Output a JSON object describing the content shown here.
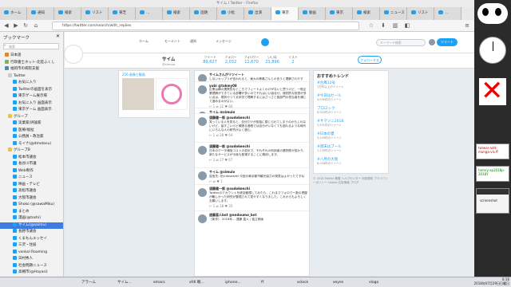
{
  "window": {
    "title": "サイム / Twitter - Firefox"
  },
  "tabs": [
    {
      "label": "ホーム"
    },
    {
      "label": "通知"
    },
    {
      "label": "検索"
    },
    {
      "label": "リスト"
    },
    {
      "label": "東芝"
    },
    {
      "label": "…"
    },
    {
      "label": "検索"
    },
    {
      "label": "話題"
    },
    {
      "label": "小松"
    },
    {
      "label": "出演"
    },
    {
      "label": "東京"
    },
    {
      "label": "動画"
    },
    {
      "label": "東京"
    },
    {
      "label": "検索"
    },
    {
      "label": "ニュース"
    },
    {
      "label": "リスト"
    },
    {
      "label": "…"
    }
  ],
  "navbar": {
    "url": "https://twitter.com/search/with_replies"
  },
  "sidebar": {
    "title": "ブックマーク",
    "search_placeholder": "検索",
    "items": [
      {
        "label": "日本語",
        "color": "#d88a2e"
      },
      {
        "label": "行政書士ネット-北陸ふくし",
        "color": "#8a6"
      },
      {
        "label": "福岡市の病院支援",
        "color": "#58a"
      },
      {
        "label": "Twitter",
        "color": "#ccc"
      },
      {
        "label": "お気に入り",
        "color": "#1da1f2"
      },
      {
        "label": "Twitterの画面を表示",
        "color": "#1da1f2"
      },
      {
        "label": "東京ゲーム展示場",
        "color": "#1da1f2"
      },
      {
        "label": "お気に入り 画面表示",
        "color": "#1da1f2"
      },
      {
        "label": "東京ゲーム 画面表示",
        "color": "#1da1f2"
      },
      {
        "label": "グループ",
        "color": "#e8c34a"
      },
      {
        "label": "実業家/評論家",
        "color": "#1da1f2"
      },
      {
        "label": "医療/福祉",
        "color": "#1da1f2"
      },
      {
        "label": "公務員・政治家",
        "color": "#1da1f2"
      },
      {
        "label": "モイナ(@dmotosu)",
        "color": "#1da1f2"
      },
      {
        "label": "グループB",
        "color": "#e8c34a"
      },
      {
        "label": "松本市議会",
        "color": "#1da1f2"
      },
      {
        "label": "長谷川市議",
        "color": "#1da1f2"
      },
      {
        "label": "Web制作",
        "color": "#1da1f2"
      },
      {
        "label": "ニュース",
        "color": "#1da1f2"
      },
      {
        "label": "映画・テレビ",
        "color": "#1da1f2"
      },
      {
        "label": "高松市議会",
        "color": "#1da1f2"
      },
      {
        "label": "大阪市議会",
        "color": "#1da1f2"
      },
      {
        "label": "Shoko (@sawaMiku)",
        "color": "#1da1f2"
      },
      {
        "label": "まとめ",
        "color": "#1da1f2"
      },
      {
        "label": "漫画(@toshi)",
        "color": "#1da1f2"
      },
      {
        "label": "サイム(@saimu)",
        "color": "#1da1f2"
      },
      {
        "label": "長野市議会",
        "color": "#1da1f2"
      },
      {
        "label": "くまもんエッセイ",
        "color": "#1da1f2"
      },
      {
        "label": "三沢・住居",
        "color": "#1da1f2"
      },
      {
        "label": "vonkol Roaming",
        "color": "#1da1f2"
      },
      {
        "label": "日村秀人",
        "color": "#1da1f2"
      },
      {
        "label": "社会問題ニュース",
        "color": "#1da1f2"
      },
      {
        "label": "高槻市(@Hayasi)",
        "color": "#1da1f2"
      }
    ],
    "selected_index": 25
  },
  "twitter": {
    "nav": [
      "ホーム",
      "モーメント",
      "通知",
      "メッセージ"
    ],
    "search_placeholder": "キーワード検索",
    "tweet_button": "ツイート",
    "profile_name": "サイム",
    "profile_handle": "@simuio",
    "stats": [
      {
        "label": "ツイート",
        "value": "89,627"
      },
      {
        "label": "フォロー",
        "value": "2,032"
      },
      {
        "label": "フォロワー",
        "value": "11,670"
      },
      {
        "label": "いいね",
        "value": "23,896"
      },
      {
        "label": "リスト",
        "value": "2"
      }
    ],
    "follow_button": "フォローする",
    "media_label": "256 画像と動画",
    "tweets": [
      {
        "name": "サイムさんがリツイート",
        "text": "しないカップリが言われると、東大の教員さんとか言うと理解されやすい。",
        "actions": "↩ 1  ⇄ 3  ♥ 5"
      },
      {
        "name": "yubi @takmy08",
        "text": "企業は横の連携的なところでフィードよくわけがないと思うけど、一般企業理解ができている部署が多いのでそれはいい組合せ。個別的な役割が多い点は、現状やってる状況で理解するにはさっさと各部門の担当者を通じて進めるのがよい。",
        "actions": "↩ 1  ⇄ 21  ♥ 60"
      },
      {
        "name": "サイム @simuio",
        "text": "このスレッドを表示",
        "actions": ""
      },
      {
        "name": "須藤健一郎 @sudokenchi",
        "text": "笑っている人を見ると、自分だけが孤独に感じられてしまうのかもしれないけど、皆すごいけど頑張る過程では自分がいなくても回れるような時代にいろんな人の研究がよく進む。",
        "actions": "↩ 1  ⇄ 28  ♥ 64"
      },
      {
        "name": "須藤健一郎 @sudokenchi",
        "text": "日本のデータ通信コストの変化で、それぞれの利用者の選択肢が変わり、新たなサービスが今後も登場することに期待します。",
        "actions": "↩ 2  ⇄ 27  ♥ 67"
      },
      {
        "name": "サイム @simuio",
        "text": "返信先: @yutosasaki 今回の東京都市観光協力の発表はよかったですね",
        "actions": "↩  ⇄  ♥ 1"
      },
      {
        "name": "須藤健一郎 @sudokenchi",
        "text": "Twitterのアカウントを統括管理してみたら、これまでフォロワー数の把握が難しかった研究が整理されて見やすくなりました。これからもよろしくお願いします。",
        "actions": "↩ 1  ⇄ 18  ♥ 35"
      },
      {
        "name": "遠藤直人bot @endoumo_bot",
        "text": "［新作］ 2018年… 遠藤 直人 / 独立映画",
        "actions": ""
      }
    ],
    "trends_title": "おすすめトレンド",
    "trends": [
      {
        "tag": "#台風12号",
        "sub": "1万件以上のツイート"
      },
      {
        "tag": "#今日はセール",
        "sub": "4,030件のツイート"
      },
      {
        "tag": "ブロロック",
        "sub": "6,022件のツイート"
      },
      {
        "tag": "#サマソニ2018",
        "sub": "2,531件のツイート"
      },
      {
        "tag": "#日本の夏",
        "sub": "5,104件のツイート"
      },
      {
        "tag": "#週末はプール",
        "sub": "1,239件のツイート"
      },
      {
        "tag": "#八月の大阪",
        "sub": "8,018件のツイート"
      }
    ],
    "footer": "© 2018 Twitter 概要 ヘルプセンター 利用規約 プライバシーポリシー Cookie 広告情報 ブログ"
  },
  "right_panel": {
    "widget_sticky_1": "screenshot",
    "widget_sticky_2": "twiwar-add-manga-vis.ff",
    "widget_sticky_3": "tomny-xp2018p-2018Y",
    "widget_sticky_4": "screenshot"
  },
  "taskbar": {
    "items": [
      "アラーム",
      "サイム...",
      "emacs",
      "xfdl 端...",
      "iphone...",
      "ff",
      "xclock",
      "xeyes",
      "xlogo"
    ],
    "clock_time": "6:16",
    "clock_date": "2018年07月29日日曜日"
  },
  "colors": {
    "twitter_blue": "#1da1f2",
    "sidebar_selected": "#3d7be0"
  }
}
